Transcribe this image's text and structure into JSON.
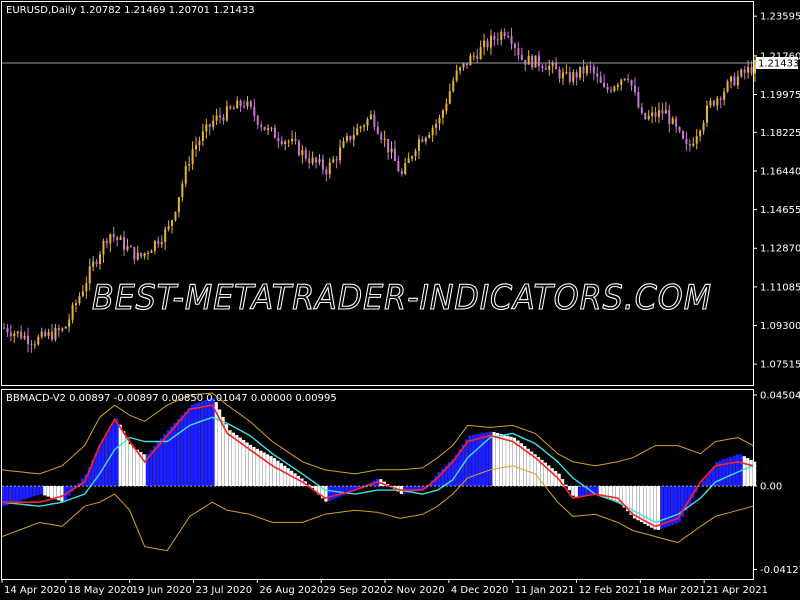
{
  "colors": {
    "background": "#000000",
    "frame": "#ffffff",
    "grid": "#ffffff",
    "bull_candle": "#e3b53b",
    "bear_candle": "#c57ad0",
    "hist_up": "#1e20ff",
    "hist_down": "#ffffff",
    "signal": "#ff2020",
    "band_mid": "#3ce0e0",
    "band_outer": "#d8a020",
    "price_line": "#a0a0a0"
  },
  "watermark": "BEST-METATRADER-INDICATORS.COM",
  "chart_data": [
    {
      "type": "candlestick",
      "header": "EURUSD,Daily  1.20782 1.21469 1.20701 1.21433",
      "current_price": 1.21433,
      "current_price_label": "1.21433",
      "ylim": [
        1.0655,
        1.2425
      ],
      "y_ticks": [
        1.23595,
        1.2176,
        1.19975,
        1.18225,
        1.1644,
        1.14655,
        1.1287,
        1.11085,
        1.093,
        1.07515
      ],
      "y_tick_labels": [
        "1.23595",
        "1.21760",
        "1.19975",
        "1.18225",
        "1.16440",
        "1.14655",
        "1.12870",
        "1.11085",
        "1.09300",
        "1.07515"
      ],
      "path_x": [
        0,
        0.04,
        0.08,
        0.12,
        0.14,
        0.18,
        0.22,
        0.25,
        0.28,
        0.32,
        0.35,
        0.38,
        0.41,
        0.43,
        0.46,
        0.49,
        0.51,
        0.53,
        0.55,
        0.58,
        0.6,
        0.62,
        0.65,
        0.67,
        0.69,
        0.72,
        0.75,
        0.78,
        0.8,
        0.83,
        0.85,
        0.88,
        0.91,
        0.94,
        0.97,
        1.0
      ],
      "path_y": [
        1.092,
        1.086,
        1.091,
        1.122,
        1.136,
        1.124,
        1.138,
        1.174,
        1.188,
        1.196,
        1.183,
        1.178,
        1.169,
        1.165,
        1.18,
        1.19,
        1.176,
        1.162,
        1.178,
        1.188,
        1.208,
        1.216,
        1.225,
        1.23,
        1.216,
        1.214,
        1.207,
        1.212,
        1.201,
        1.21,
        1.188,
        1.192,
        1.174,
        1.195,
        1.206,
        1.213
      ]
    },
    {
      "type": "line+bar",
      "header": "BBMACD-V2 0.00897 -0.00897 0.00850 0.01047 0.00000 0.00995",
      "ylim": [
        -0.046,
        0.0475
      ],
      "y_ticks": [
        0.04504,
        0.0,
        -0.04127
      ],
      "y_tick_labels": [
        "0.04504",
        "0.00",
        "-0.04127"
      ],
      "histogram_x": [
        0,
        0.05,
        0.08,
        0.11,
        0.13,
        0.15,
        0.17,
        0.19,
        0.22,
        0.25,
        0.28,
        0.3,
        0.33,
        0.36,
        0.4,
        0.43,
        0.47,
        0.5,
        0.53,
        0.56,
        0.58,
        0.6,
        0.62,
        0.65,
        0.68,
        0.71,
        0.74,
        0.76,
        0.79,
        0.82,
        0.84,
        0.87,
        0.9,
        0.93,
        0.95,
        0.98,
        1.0
      ],
      "histogram_y": [
        -0.01,
        -0.004,
        -0.008,
        0.006,
        0.022,
        0.034,
        0.02,
        0.015,
        0.028,
        0.04,
        0.044,
        0.028,
        0.02,
        0.014,
        0.003,
        -0.008,
        -0.002,
        0.004,
        -0.004,
        -0.002,
        0.007,
        0.014,
        0.025,
        0.027,
        0.024,
        0.015,
        0.006,
        -0.006,
        -0.004,
        -0.008,
        -0.016,
        -0.022,
        -0.018,
        0.002,
        0.012,
        0.016,
        0.012
      ],
      "signal_y": [
        -0.008,
        -0.008,
        -0.005,
        0.002,
        0.02,
        0.033,
        0.022,
        0.012,
        0.025,
        0.038,
        0.04,
        0.026,
        0.018,
        0.01,
        0.002,
        -0.006,
        -0.002,
        0.002,
        -0.002,
        -0.002,
        0.004,
        0.012,
        0.022,
        0.025,
        0.022,
        0.014,
        0.004,
        -0.006,
        -0.004,
        -0.006,
        -0.014,
        -0.02,
        -0.016,
        0.002,
        0.01,
        0.012,
        0.01
      ],
      "band_mid_y": [
        -0.008,
        -0.01,
        -0.008,
        -0.004,
        0.006,
        0.018,
        0.024,
        0.022,
        0.022,
        0.03,
        0.034,
        0.031,
        0.025,
        0.016,
        0.006,
        -0.002,
        -0.004,
        -0.002,
        -0.002,
        -0.004,
        -0.002,
        0.003,
        0.014,
        0.024,
        0.026,
        0.021,
        0.012,
        0.004,
        -0.004,
        -0.008,
        -0.012,
        -0.018,
        -0.014,
        -0.006,
        0.002,
        0.007,
        0.01
      ],
      "band_upper_y": [
        0.008,
        0.006,
        0.01,
        0.02,
        0.034,
        0.04,
        0.035,
        0.032,
        0.04,
        0.045,
        0.046,
        0.04,
        0.032,
        0.022,
        0.012,
        0.008,
        0.006,
        0.008,
        0.008,
        0.009,
        0.014,
        0.02,
        0.03,
        0.029,
        0.03,
        0.026,
        0.016,
        0.012,
        0.01,
        0.012,
        0.014,
        0.02,
        0.02,
        0.016,
        0.022,
        0.024,
        0.02
      ],
      "band_lower_y": [
        -0.025,
        -0.018,
        -0.02,
        -0.01,
        -0.008,
        -0.004,
        -0.012,
        -0.03,
        -0.032,
        -0.015,
        -0.008,
        -0.012,
        -0.014,
        -0.018,
        -0.018,
        -0.014,
        -0.012,
        -0.013,
        -0.016,
        -0.014,
        -0.01,
        -0.004,
        0.004,
        0.008,
        0.01,
        0.006,
        -0.008,
        -0.015,
        -0.014,
        -0.018,
        -0.022,
        -0.025,
        -0.028,
        -0.02,
        -0.015,
        -0.012,
        -0.01
      ]
    }
  ],
  "x_axis": {
    "labels": [
      "14 Apr 2020",
      "18 May 2020",
      "19 Jun 2020",
      "23 Jul 2020",
      "26 Aug 2020",
      "29 Sep 2020",
      "2 Nov 2020",
      "4 Dec 2020",
      "11 Jan 2021",
      "12 Feb 2021",
      "18 Mar 2021",
      "21 Apr 2021"
    ],
    "label_positions": [
      0.0,
      0.085,
      0.17,
      0.255,
      0.34,
      0.425,
      0.51,
      0.595,
      0.68,
      0.765,
      0.85,
      0.935
    ]
  }
}
